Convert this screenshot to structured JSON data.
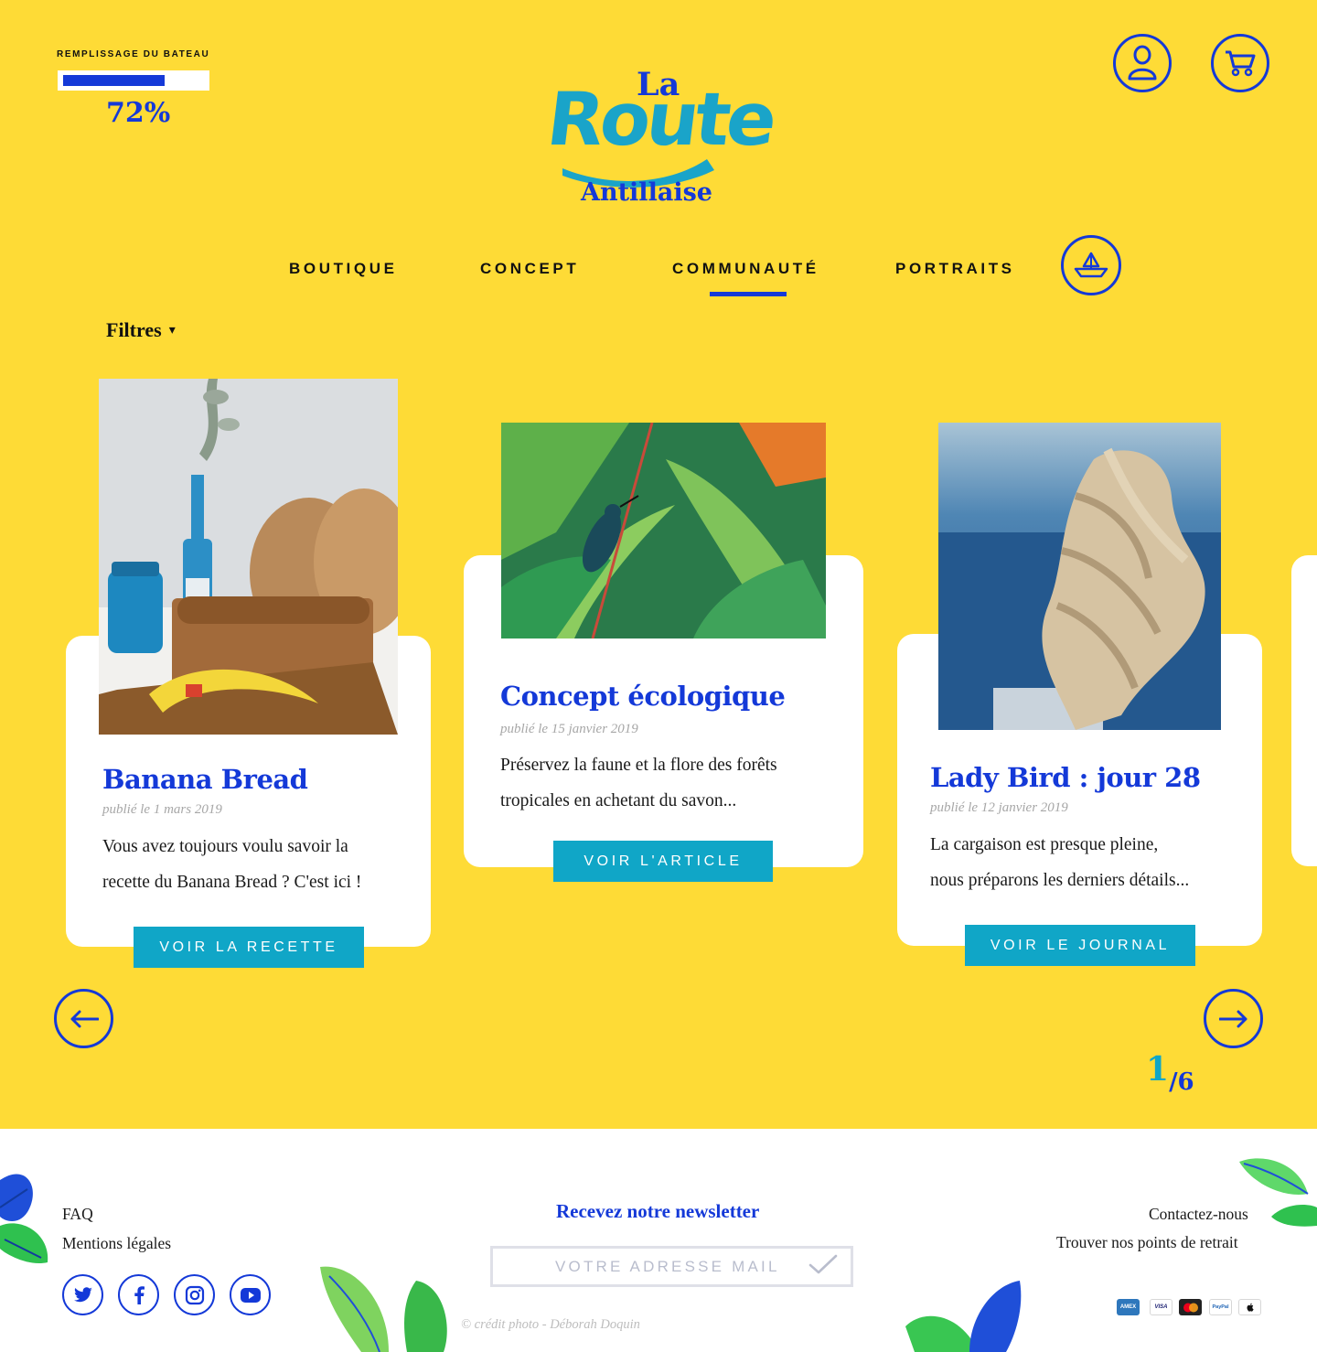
{
  "boat_fill": {
    "label": "REMPLISSAGE DU BATEAU",
    "percent": 72,
    "percent_text": "72%"
  },
  "logo": {
    "la": "La",
    "route": "Route",
    "antillaise": "Antillaise"
  },
  "icons": {
    "account": "user-icon",
    "cart": "cart-icon",
    "boat": "boat-icon"
  },
  "nav": {
    "items": [
      "BOUTIQUE",
      "CONCEPT",
      "COMMUNAUTÉ",
      "PORTRAITS"
    ],
    "active": "COMMUNAUTÉ"
  },
  "filters": {
    "label": "Filtres",
    "arrow": "▾"
  },
  "cards": [
    {
      "title": "Banana Bread",
      "date": "publié le 1 mars 2019",
      "text_line1": "Vous avez toujours voulu savoir la",
      "text_line2": "recette du Banana Bread ? C'est ici !",
      "cta": "VOIR LA RECETTE"
    },
    {
      "title": "Concept écologique",
      "date": "publié le 15 janvier 2019",
      "text_line1": "Préservez la faune et la flore des forêts",
      "text_line2": "tropicales en achetant du savon...",
      "cta": "VOIR L'ARTICLE"
    },
    {
      "title": "Lady Bird : jour 28",
      "date": "publié le 12 janvier 2019",
      "text_line1": "La cargaison est presque pleine,",
      "text_line2": "nous préparons les derniers détails...",
      "cta": "VOIR LE JOURNAL"
    }
  ],
  "pager": {
    "current": "1",
    "total": "/6"
  },
  "footer": {
    "links_left": [
      "FAQ",
      "Mentions légales"
    ],
    "newsletter_title": "Recevez notre newsletter",
    "newsletter_placeholder": "VOTRE ADRESSE MAIL",
    "links_right": [
      "Contactez-nous",
      "Trouver nos points de retrait"
    ],
    "credit": "© crédit photo - Déborah Doquin",
    "social": [
      "twitter-icon",
      "facebook-icon",
      "instagram-icon",
      "youtube-icon"
    ],
    "payments": [
      "AMEX",
      "VISA",
      "mastercard",
      "PayPal",
      "apple-pay"
    ]
  },
  "colors": {
    "yellow": "#fedb36",
    "blue": "#1439d8",
    "teal": "#10a6c7",
    "white": "#ffffff"
  }
}
